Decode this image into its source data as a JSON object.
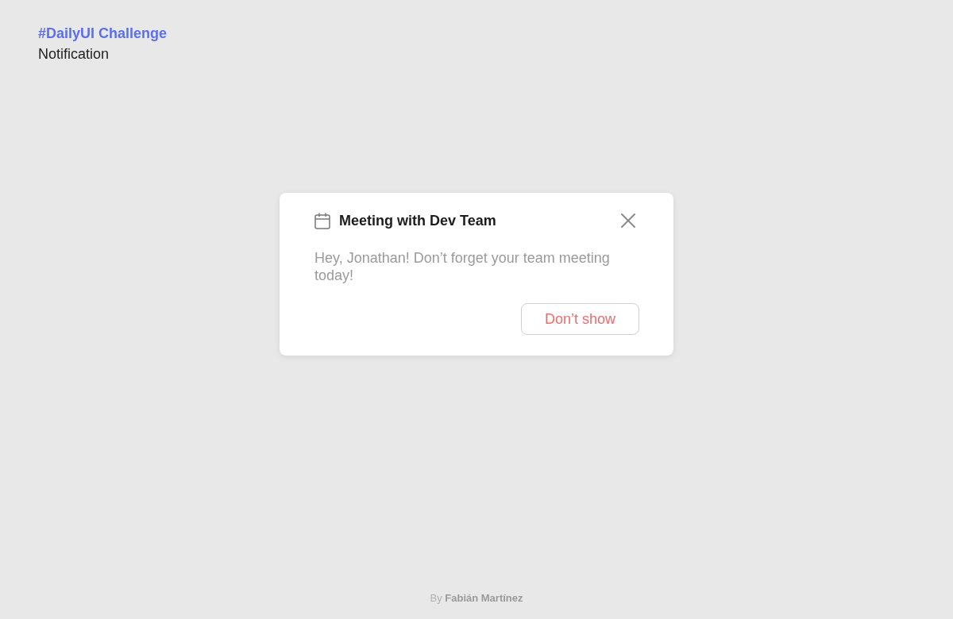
{
  "header": {
    "title": "#DailyUI Challenge",
    "subtitle": "Notification"
  },
  "notification": {
    "title": "Meeting with Dev Team",
    "message": "Hey, Jonathan! Don’t forget your team meeting today!",
    "action": "Don’t show"
  },
  "footer": "By **Fabián Martínez**"
}
